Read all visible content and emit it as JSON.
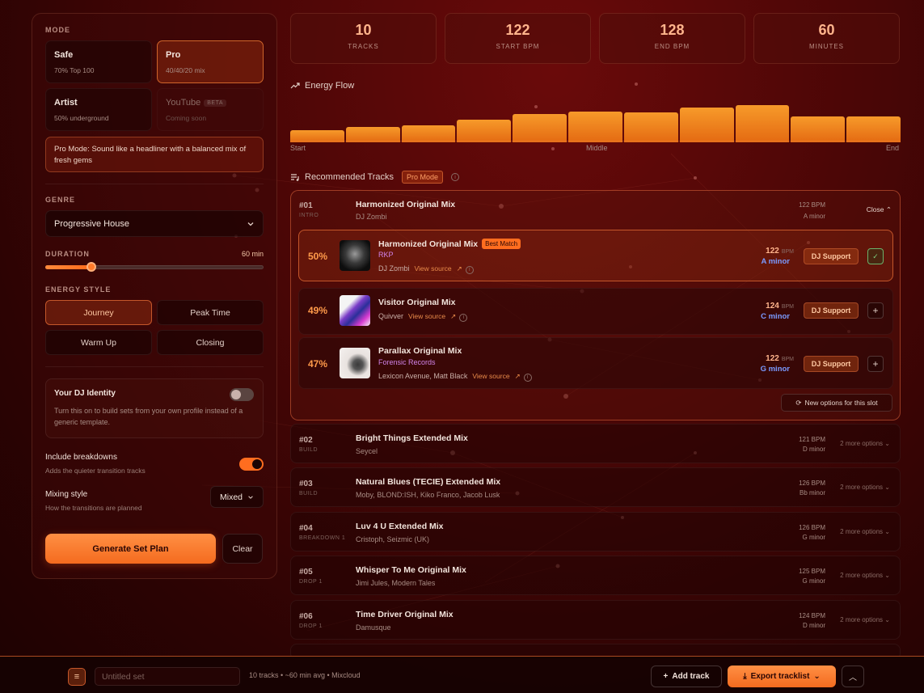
{
  "sidebar": {
    "mode_label": "MODE",
    "modes": [
      {
        "title": "Safe",
        "sub": "70% Top 100"
      },
      {
        "title": "Pro",
        "sub": "40/40/20 mix"
      },
      {
        "title": "Artist",
        "sub": "50% underground"
      },
      {
        "title": "YouTube",
        "badge": "BETA",
        "sub": "Coming soon"
      }
    ],
    "mode_note": "Pro Mode: Sound like a headliner with a balanced mix of fresh gems",
    "genre_label": "GENRE",
    "genre_value": "Progressive House",
    "duration_label": "DURATION",
    "duration_value": "60 min",
    "duration_fraction": 0.21,
    "energy_label": "ENERGY STYLE",
    "energy": [
      "Journey",
      "Peak Time",
      "Warm Up",
      "Closing"
    ],
    "identity_title": "Your DJ Identity",
    "identity_desc": "Turn this on to build sets from your own profile instead of a generic template.",
    "breakdowns_title": "Include breakdowns",
    "breakdowns_desc": "Adds the quieter transition tracks",
    "mixing_title": "Mixing style",
    "mixing_desc": "How the transitions are planned",
    "mixing_value": "Mixed",
    "generate_label": "Generate Set Plan",
    "clear_label": "Clear"
  },
  "stats": [
    {
      "value": "10",
      "label": "TRACKS"
    },
    {
      "value": "122",
      "label": "START BPM"
    },
    {
      "value": "128",
      "label": "END BPM"
    },
    {
      "value": "60",
      "label": "MINUTES"
    }
  ],
  "energy_flow": {
    "title": "Energy Flow",
    "levels": [
      0.26,
      0.34,
      0.38,
      0.5,
      0.62,
      0.68,
      0.66,
      0.76,
      0.82,
      0.58,
      0.58
    ],
    "start_label": "Start",
    "middle_label": "Middle",
    "end_label": "End"
  },
  "recommended": {
    "title": "Recommended Tracks",
    "mode_pill": "Pro Mode",
    "open_slot": {
      "num": "#01",
      "tag": "INTRO",
      "name": "Harmonized Original Mix",
      "artist": "DJ Zombi",
      "bpm": "122 BPM",
      "key": "A minor",
      "close_label": "Close"
    },
    "candidates": [
      {
        "pct": "50%",
        "name": "Harmonized Original Mix",
        "badge": "Best Match",
        "label": "RKP",
        "artist": "DJ Zombi",
        "source": "View source",
        "bpm": "122",
        "bpm_unit": "BPM",
        "key": "A minor",
        "support": "DJ Support"
      },
      {
        "pct": "49%",
        "name": "Visitor Original Mix",
        "label": "",
        "artist": "Quivver",
        "source": "View source",
        "bpm": "124",
        "bpm_unit": "BPM",
        "key": "C minor",
        "support": "DJ Support"
      },
      {
        "pct": "47%",
        "name": "Parallax Original Mix",
        "label": "Forensic Records",
        "artist": "Lexicon Avenue, Matt Black",
        "source": "View source",
        "bpm": "122",
        "bpm_unit": "BPM",
        "key": "G minor",
        "support": "DJ Support"
      }
    ],
    "new_options_label": "New options for this slot",
    "slots": [
      {
        "num": "#02",
        "tag": "BUILD",
        "name": "Bright Things Extended Mix",
        "artist": "Seycel",
        "bpm": "121 BPM",
        "key": "D minor",
        "more": "2 more options"
      },
      {
        "num": "#03",
        "tag": "BUILD",
        "name": "Natural Blues (TECIE) Extended Mix",
        "artist": "Moby, BLOND:ISH, Kiko Franco, Jacob Lusk",
        "bpm": "126 BPM",
        "key": "Bb minor",
        "more": "2 more options"
      },
      {
        "num": "#04",
        "tag": "BREAKDOWN 1",
        "name": "Luv 4 U Extended Mix",
        "artist": "Cristoph, Seizmic (UK)",
        "bpm": "126 BPM",
        "key": "G minor",
        "more": "2 more options"
      },
      {
        "num": "#05",
        "tag": "DROP 1",
        "name": "Whisper To Me Original Mix",
        "artist": "Jimi Jules, Modern Tales",
        "bpm": "125 BPM",
        "key": "G minor",
        "more": "2 more options"
      },
      {
        "num": "#06",
        "tag": "DROP 1",
        "name": "Time Driver Original Mix",
        "artist": "Damusque",
        "bpm": "124 BPM",
        "key": "D minor",
        "more": "2 more options"
      }
    ]
  },
  "footer": {
    "set_placeholder": "Untitled set",
    "meta": "10 tracks • ~60 min avg • Mixcloud",
    "add_label": "Add track",
    "export_label": "Export tracklist"
  },
  "colors": {
    "accent": "#ff6d1f",
    "key_blue": "#7a9aff",
    "label_purple": "#d083e8"
  }
}
